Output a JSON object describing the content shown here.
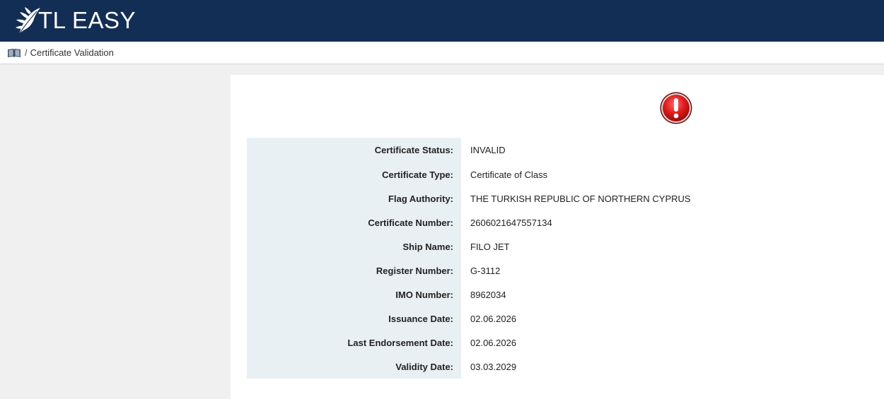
{
  "header": {
    "brand": "TL EASY",
    "logo_icon": "feather-icon",
    "background_color": "#132e55"
  },
  "breadcrumb": {
    "icon": "book-icon",
    "separator": "/",
    "current": "Certificate Validation"
  },
  "status_indicator": {
    "icon": "alert-exclamation-icon",
    "color": "#e01b1b"
  },
  "certificate": {
    "fields": [
      {
        "label": "Certificate Status:",
        "value": "INVALID"
      },
      {
        "label": "Certificate Type:",
        "value": "Certificate of Class"
      },
      {
        "label": "Flag Authority:",
        "value": "THE TURKISH REPUBLIC OF NORTHERN CYPRUS"
      },
      {
        "label": "Certificate Number:",
        "value": "2606021647557134"
      },
      {
        "label": "Ship Name:",
        "value": "FILO JET"
      },
      {
        "label": "Register Number:",
        "value": "G-3112"
      },
      {
        "label": "IMO Number:",
        "value": "8962034"
      },
      {
        "label": "Issuance Date:",
        "value": "02.06.2026"
      },
      {
        "label": "Last Endorsement Date:",
        "value": "02.06.2026"
      },
      {
        "label": "Validity Date:",
        "value": "03.03.2029"
      }
    ]
  }
}
